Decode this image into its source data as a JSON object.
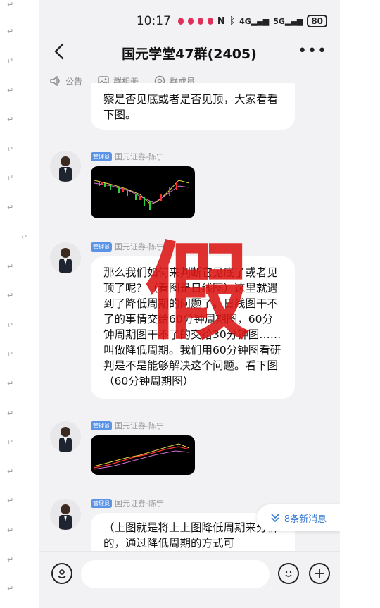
{
  "paragraph_mark": "↵",
  "status": {
    "time": "10:17",
    "battery": "80",
    "net1": "4G",
    "net2": "5G"
  },
  "nav": {
    "title": "国元学堂47群(2405)",
    "more": "•••"
  },
  "tabs": [
    "公告",
    "群相册",
    "群成员"
  ],
  "sender": {
    "badge": "管理员",
    "name": "国元证券-陈宁"
  },
  "messages": {
    "top_partial": "察是否见底或者是否见顶，大家看看下图。",
    "middle": "那么我们如何来判断它见底了或者见顶了呢？（看图是日线图）这里就遇到了降低周期的问题了。日线图干不了的事情交给60分钟周期图，60分钟周期图干不了的交给30分钟图……叫做降低周期。我们用60分钟图看研判是不是能够解决这个问题。看下图（60分钟周期图）",
    "bottom_partial": "（上图就是将上上图降低周期来分析的，通过降低周期的方式可"
  },
  "new_messages": "8条新消息",
  "watermark": "假",
  "colors": {
    "badge": "#5b93e6",
    "watermark": "#dc1414",
    "accent": "#3a7bd5"
  }
}
